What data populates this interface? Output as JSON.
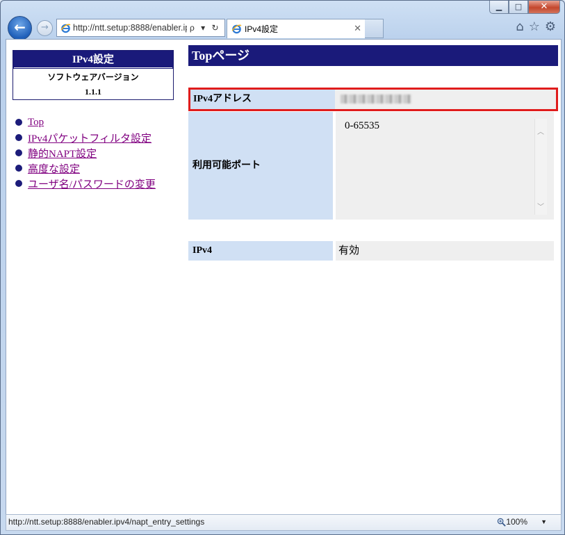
{
  "window": {
    "min_label": "▁",
    "max_label": "□",
    "close_label": "✕"
  },
  "browser": {
    "address": "http://ntt.setup:8888/enabler.ipv4/",
    "address_tools": "ρ ▾ ↻",
    "tab_title": "IPv4設定",
    "tab_close": "✕",
    "home_icon": "⌂",
    "favorites_icon": "☆",
    "tools_icon": "⚙",
    "status_url": "http://ntt.setup:8888/enabler.ipv4/napt_entry_settings",
    "zoom": "100%"
  },
  "sidebar": {
    "title": "IPv4設定",
    "subtitle": "ソフトウェアバージョン",
    "version": "1.1.1",
    "items": [
      {
        "label": "Top"
      },
      {
        "label": "IPv4パケットフィルタ設定"
      },
      {
        "label": "静的NAPT設定"
      },
      {
        "label": "高度な設定"
      },
      {
        "label": "ユーザ名/パスワードの変更"
      }
    ]
  },
  "main": {
    "page_title": "Topページ",
    "ipv4_address_label": "IPv4アドレス",
    "port_label": "利用可能ポート",
    "port_value": "0-65535",
    "ipv4_label": "IPv4",
    "ipv4_value": "有効"
  }
}
